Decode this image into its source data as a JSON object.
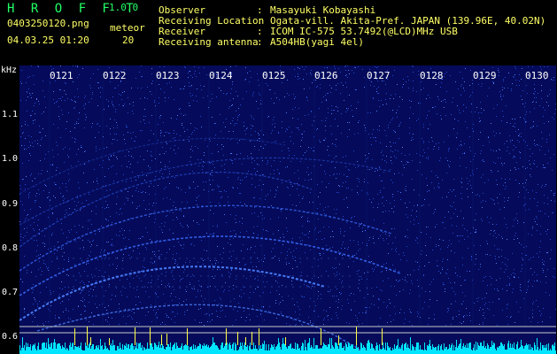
{
  "header": {
    "app_title": "H R O F F T",
    "app_version": "1.0.0",
    "file_name": "0403250120.png",
    "meteor_label": "meteor",
    "time_stamp": "04.03.25 01:20",
    "meteor_count": "20"
  },
  "info": [
    {
      "label": "Observer",
      "value": "Masayuki Kobayashi"
    },
    {
      "label": "Receiving Location",
      "value": "Ogata-vill. Akita-Pref. JAPAN (139.96E, 40.02N)"
    },
    {
      "label": "Receiver",
      "value": "ICOM IC-575 53.7492(@LCD)MHz USB"
    },
    {
      "label": "Receiving antenna",
      "value": "A504HB(yagi 4el)"
    }
  ],
  "info_colon": ":",
  "axis": {
    "unit_label": "kHz",
    "y_ticks": [
      "1.1",
      "1.0",
      "0.9",
      "0.8",
      "0.7",
      "0.6"
    ],
    "x_ticks": [
      "0121",
      "0122",
      "0123",
      "0124",
      "0125",
      "0126",
      "0127",
      "0128",
      "0129",
      "0130"
    ]
  },
  "colors": {
    "background": "#000000",
    "plot_background": "#050b5a",
    "title_green": "#22ff66",
    "text_yellow": "#ffff66",
    "signal_blue": "#2a6bff",
    "level_cyan": "#00e5ff"
  }
}
